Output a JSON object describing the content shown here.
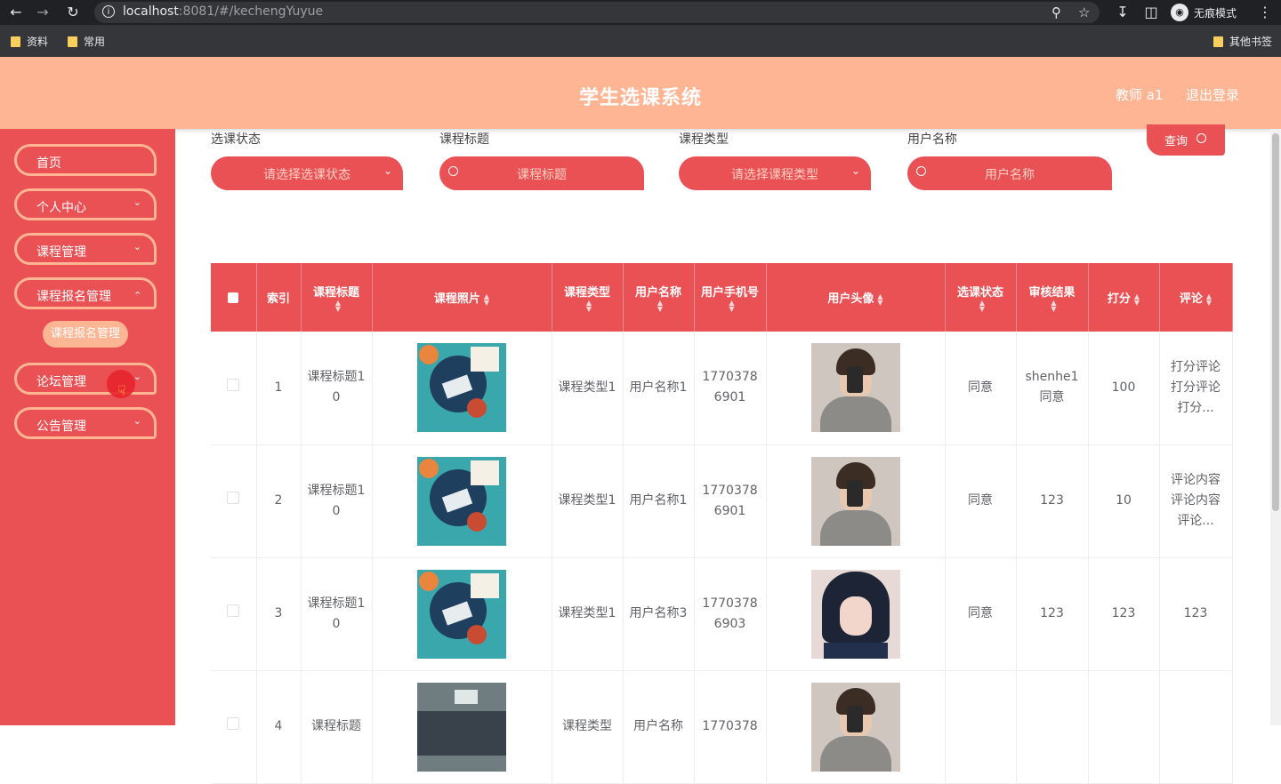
{
  "browser": {
    "url_host": "localhost",
    "url_rest": ":8081/#/kechengYuyue",
    "incognito_label": "无痕模式",
    "bookmarks": [
      "资料",
      "常用"
    ],
    "other_bookmarks": "其他书签"
  },
  "header": {
    "title": "学生选课系统",
    "user": "教师 a1",
    "logout": "退出登录"
  },
  "sidebar": {
    "items": [
      {
        "label": "首页",
        "chevron": false
      },
      {
        "label": "个人中心",
        "chevron": true
      },
      {
        "label": "课程管理",
        "chevron": true
      },
      {
        "label": "课程报名管理",
        "chevron": true
      },
      {
        "label": "论坛管理",
        "chevron": true
      },
      {
        "label": "公告管理",
        "chevron": true
      }
    ],
    "active_sub": "课程报名管理"
  },
  "search": {
    "status_label": "选课状态",
    "status_placeholder": "请选择选课状态",
    "title_label": "课程标题",
    "title_placeholder": "课程标题",
    "type_label": "课程类型",
    "type_placeholder": "请选择课程类型",
    "user_label": "用户名称",
    "user_placeholder": "用户名称",
    "query_button": "查询"
  },
  "table": {
    "headers": [
      "索引",
      "课程标题",
      "课程照片",
      "课程类型",
      "用户名称",
      "用户手机号",
      "用户头像",
      "选课状态",
      "审核结果",
      "打分",
      "评论"
    ],
    "rows": [
      {
        "index": "1",
        "title": "课程标题10",
        "photo": "course",
        "type": "课程类型1",
        "user": "用户名称1",
        "phone": "17703786901",
        "avatar": "male",
        "status": "同意",
        "review": "shenhe1同意",
        "score": "100",
        "comment": "打分评论打分评论打分..."
      },
      {
        "index": "2",
        "title": "课程标题10",
        "photo": "course",
        "type": "课程类型1",
        "user": "用户名称1",
        "phone": "17703786901",
        "avatar": "male",
        "status": "同意",
        "review": "123",
        "score": "10",
        "comment": "评论内容评论内容评论..."
      },
      {
        "index": "3",
        "title": "课程标题10",
        "photo": "course",
        "type": "课程类型1",
        "user": "用户名称3",
        "phone": "17703786903",
        "avatar": "female",
        "status": "同意",
        "review": "123",
        "score": "123",
        "comment": "123"
      },
      {
        "index": "4",
        "title": "课程标题",
        "photo": "classroom",
        "type": "课程类型",
        "user": "用户名称",
        "phone": "1770378",
        "avatar": "male",
        "status": "",
        "review": "",
        "score": "",
        "comment": ""
      }
    ]
  }
}
